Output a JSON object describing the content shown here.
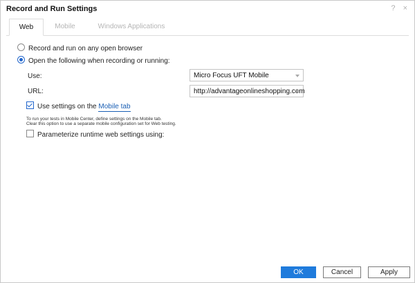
{
  "dialog": {
    "title": "Record and Run Settings",
    "help_glyph": "?",
    "close_glyph": "×"
  },
  "tabs": [
    {
      "label": "Web",
      "active": true
    },
    {
      "label": "Mobile",
      "active": false
    },
    {
      "label": "Windows Applications",
      "active": false
    }
  ],
  "options": {
    "record_any": {
      "label": "Record and run on any open browser",
      "selected": false
    },
    "open_following": {
      "label": "Open the following when recording or running:",
      "selected": true
    }
  },
  "use": {
    "label": "Use:",
    "value": "Micro Focus UFT Mobile"
  },
  "url": {
    "label": "URL:",
    "value": "http://advantageonlineshopping.com"
  },
  "use_mobile_settings": {
    "checked": true,
    "label": "Use settings on the ",
    "link": "Mobile tab"
  },
  "note": {
    "line1": "To run your tests in Mobile Center, define settings on the Mobile tab.",
    "line2": "Clear this option to use a separate mobile configuration set for Web testing."
  },
  "parameterize": {
    "checked": false,
    "label": "Parameterize runtime web settings using:"
  },
  "buttons": {
    "ok": "OK",
    "cancel": "Cancel",
    "apply": "Apply"
  },
  "colors": {
    "accent": "#1f7bdc",
    "link": "#1a5fb4"
  }
}
